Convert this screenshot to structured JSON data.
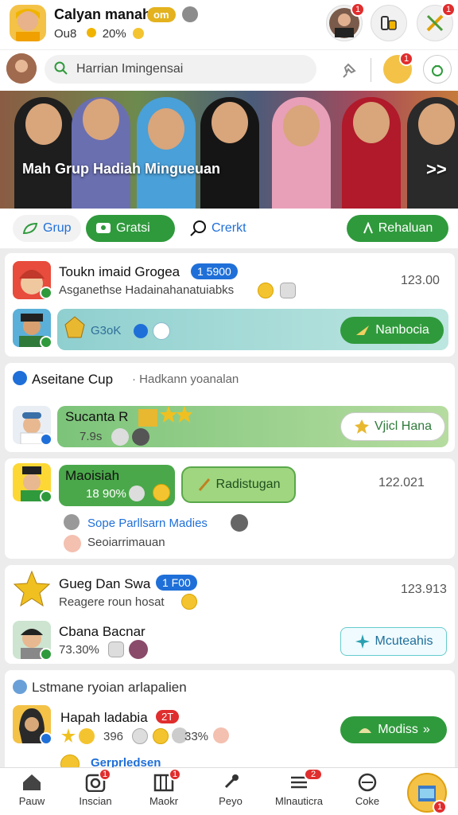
{
  "header": {
    "title": "Calyan manah",
    "badge": "om",
    "subtitle": "Ou8",
    "percent": "20%",
    "notif_count": "1",
    "menu_count": "1"
  },
  "search": {
    "placeholder": "Harrian Imingensai",
    "profile_count": "1"
  },
  "banner": {
    "text": "Mah Grup Hadiah Mingueuan",
    "next": ">>"
  },
  "tabs": [
    {
      "label": "Grup"
    },
    {
      "label": "Gratsi"
    },
    {
      "label": "Crerkt"
    },
    {
      "label": "Rehaluan"
    }
  ],
  "card1": {
    "name": "Toukn imaid Grogea",
    "badge": "1 5900",
    "sub": "Asganethse Hadainahanatuiabks",
    "num": "123.00",
    "row2_text": "G3oK",
    "row2_button": "Nanbocia"
  },
  "card2": {
    "section": "Aseitane Cup",
    "section_sub": "· Hadkann yoanalan",
    "name": "Sucanta R",
    "value": "7.9s",
    "button": "Vjicl Hana"
  },
  "card3": {
    "name": "Maoisiah",
    "value": "18 90%",
    "pill2": "Radistugan",
    "num": "122.021",
    "link": "Sope Parllsarn Madies",
    "sub": "Seoiarrimauan"
  },
  "card4": {
    "name": "Gueg Dan Swa",
    "badge": "1 F00",
    "sub": "Reagere roun hosat",
    "num": "123.913",
    "name2": "Cbana Bacnar",
    "value2": "73.30%",
    "button": "Mcuteahis"
  },
  "card5": {
    "section": "Lstmane ryoian arlapalien",
    "name": "Hapah ladabia",
    "badge": "2T",
    "stat1": "396",
    "stat2": "33%",
    "button": "Modiss",
    "peek": "Gerprledsen"
  },
  "nav": [
    {
      "label": "Pauw"
    },
    {
      "label": "Inscian",
      "count": "1"
    },
    {
      "label": "Maokr",
      "count": "1"
    },
    {
      "label": "Peyo"
    },
    {
      "label": "Mlnauticra",
      "count": "2"
    },
    {
      "label": "Coke"
    },
    {
      "label": "",
      "count": "1"
    }
  ],
  "colors": {
    "accent_green": "#2f9a3c",
    "accent_blue": "#1f6fd8",
    "badge_red": "#e02d2d",
    "gold": "#e3b21e"
  }
}
